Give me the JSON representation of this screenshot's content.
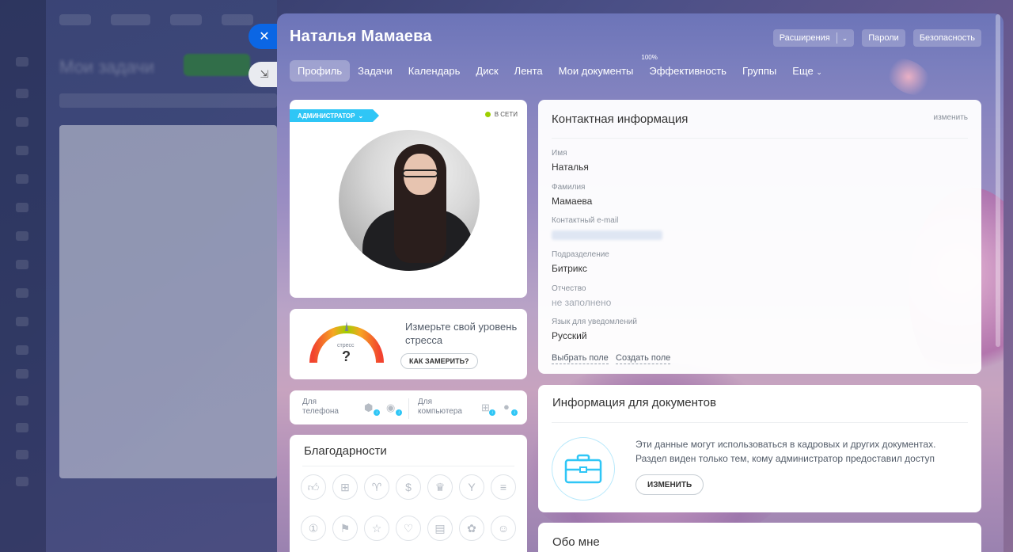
{
  "background_app": {
    "title": "Мои задачи"
  },
  "side_buttons": {
    "close_icon": "close-icon",
    "minimize_icon": "minimize-icon"
  },
  "header": {
    "user_name": "Наталья Мамаева",
    "buttons": {
      "extensions": "Расширения",
      "passwords": "Пароли",
      "security": "Безопасность"
    }
  },
  "tabs": [
    {
      "label": "Профиль",
      "active": true
    },
    {
      "label": "Задачи"
    },
    {
      "label": "Календарь"
    },
    {
      "label": "Диск"
    },
    {
      "label": "Лента"
    },
    {
      "label": "Мои документы"
    },
    {
      "label": "Эффективность",
      "badge": "100%"
    },
    {
      "label": "Группы"
    },
    {
      "label": "Еще"
    }
  ],
  "profile": {
    "role": "АДМИНИСТРАТОР",
    "status": "В СЕТИ",
    "accent_color": "#2fc6f6",
    "online_color": "#9dcf00"
  },
  "stress": {
    "gauge_label": "стресс",
    "gauge_value": "?",
    "text": "Измерьте свой уровень стресса",
    "button": "КАК ЗАМЕРИТЬ?"
  },
  "apps": {
    "phone_label_1": "Для",
    "phone_label_2": "телефона",
    "computer_label_1": "Для",
    "computer_label_2": "компьютера"
  },
  "thanks": {
    "title": "Благодарности",
    "icons": [
      "thumbs-up-icon",
      "gift-icon",
      "trophy-icon",
      "money-bag-icon",
      "crown-icon",
      "cocktail-icon",
      "cake-icon",
      "medal-icon",
      "flag-icon",
      "star-icon",
      "heart-icon",
      "beer-icon",
      "flower-icon",
      "smile-icon"
    ]
  },
  "contact": {
    "title": "Контактная информация",
    "edit": "изменить",
    "fields": {
      "first_name_label": "Имя",
      "first_name": "Наталья",
      "last_name_label": "Фамилия",
      "last_name": "Мамаева",
      "email_label": "Контактный e-mail",
      "department_label": "Подразделение",
      "department": "Битрикс",
      "patronymic_label": "Отчество",
      "patronymic": "не заполнено",
      "language_label": "Язык для уведомлений",
      "language": "Русский"
    },
    "select_field": "Выбрать поле",
    "create_field": "Создать поле"
  },
  "docs": {
    "title": "Информация для документов",
    "text_1": "Эти данные могут использоваться в кадровых и других документах.",
    "text_2": "Раздел виден только тем, кому администратор предоставил доступ",
    "button": "ИЗМЕНИТЬ"
  },
  "about": {
    "title": "Обо мне"
  }
}
